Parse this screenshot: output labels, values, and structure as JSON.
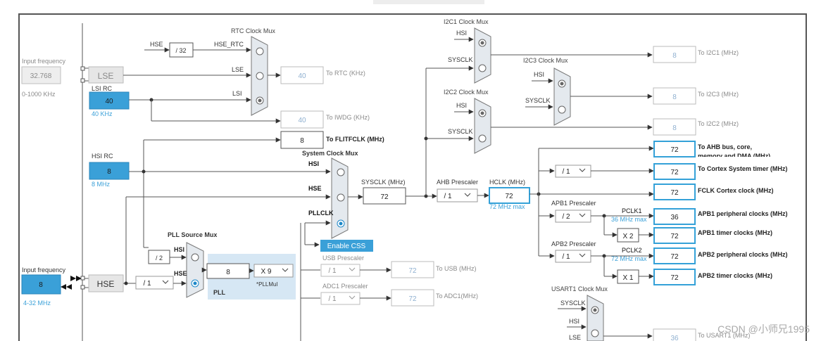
{
  "input_freq": {
    "label": "Input frequency",
    "value": "32.768",
    "range": "0-1000 KHz"
  },
  "lse": {
    "label": "LSE"
  },
  "lsi": {
    "label": "LSI RC",
    "value": "40",
    "freq": "40 KHz"
  },
  "hsi": {
    "label": "HSI RC",
    "value": "8",
    "freq": "8 MHz"
  },
  "hse_input": {
    "label": "Input frequency",
    "value": "8",
    "range": "4-32 MHz"
  },
  "hse": {
    "label": "HSE"
  },
  "rtc_mux": {
    "title": "RTC Clock Mux",
    "hse": "HSE",
    "div": "/ 32",
    "hse_rtc": "HSE_RTC",
    "lse": "LSE",
    "lsi": "LSI"
  },
  "rtc_out": {
    "value": "40",
    "label": "To RTC (KHz)"
  },
  "iwdg_out": {
    "value": "40",
    "label": "To IWDG (KHz)"
  },
  "flit_out": {
    "value": "8",
    "label": "To FLITFCLK (MHz)"
  },
  "sysmux": {
    "title": "System Clock Mux",
    "hsi": "HSI",
    "hse": "HSE",
    "pllclk": "PLLCLK"
  },
  "enable_css": "Enable CSS",
  "sysclk": {
    "label": "SYSCLK (MHz)",
    "value": "72"
  },
  "ahb": {
    "label": "AHB Prescaler",
    "value": "/ 1"
  },
  "hclk": {
    "label": "HCLK (MHz)",
    "value": "72",
    "max": "72 MHz max"
  },
  "pll_src": {
    "title": "PLL Source Mux",
    "hsi": "HSI",
    "hse": "HSE",
    "div2": "/ 2",
    "hse_div": "/ 1"
  },
  "pll": {
    "label": "PLL",
    "value": "8",
    "mul": "X 9",
    "mul_label": "*PLLMul"
  },
  "usb": {
    "label": "USB Prescaler",
    "value": "/ 1",
    "out": "72",
    "out_label": "To USB (MHz)"
  },
  "adc": {
    "label": "ADC1 Prescaler",
    "value": "/ 1",
    "out": "72",
    "out_label": "To ADC1(MHz)"
  },
  "i2c1_mux": {
    "title": "I2C1 Clock Mux",
    "hsi": "HSI",
    "sysclk": "SYSCLK",
    "out": "8",
    "out_label": "To I2C1 (MHz)"
  },
  "i2c2_mux": {
    "title": "I2C2 Clock Mux",
    "hsi": "HSI",
    "sysclk": "SYSCLK",
    "out": "8",
    "out_label": "To I2C2 (MHz)"
  },
  "i2c3_mux": {
    "title": "I2C3 Clock Mux",
    "hsi": "HSI",
    "sysclk": "SYSCLK",
    "out": "8",
    "out_label": "To I2C3 (MHz)"
  },
  "ahb_bus": {
    "value": "72",
    "label1": "To AHB bus, core,",
    "label2": "memory and DMA (MHz)"
  },
  "cortex_timer": {
    "div": "/ 1",
    "value": "72",
    "label": "To Cortex System timer (MHz)"
  },
  "fclk": {
    "value": "72",
    "label": "FCLK Cortex clock (MHz)"
  },
  "apb1": {
    "label": "APB1 Prescaler",
    "value": "/ 2",
    "pclk": "PCLK1",
    "max": "36 MHz max",
    "periph": "36",
    "periph_label": "APB1 peripheral clocks (MHz)",
    "mul": "X 2",
    "timer": "72",
    "timer_label": "APB1 timer clocks (MHz)"
  },
  "apb2": {
    "label": "APB2 Prescaler",
    "value": "/ 1",
    "pclk": "PCLK2",
    "max": "72 MHz max",
    "periph": "72",
    "periph_label": "APB2 peripheral clocks (MHz)",
    "mul": "X 1",
    "timer": "72",
    "timer_label": "APB2 timer clocks (MHz)"
  },
  "usart1": {
    "title": "USART1 Clock Mux",
    "sysclk": "SYSCLK",
    "hsi": "HSI",
    "lse": "LSE",
    "out": "36",
    "out_label": "To USART1 (MHz)"
  },
  "watermark": "CSDN @小师兄1995",
  "colors": {
    "blue_box": "#3aa0d8",
    "accent_border": "#34a1d8",
    "line": "#333333",
    "gray_text": "#8a8a8a",
    "pll_bg": "#d6e7f4",
    "mux_fill": "#e4e9ee"
  }
}
